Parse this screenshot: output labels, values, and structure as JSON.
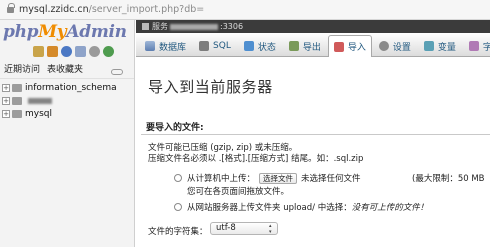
{
  "browser": {
    "url_host": "mysql.zzidc.cn",
    "url_path": "/server_import.php?db="
  },
  "logo": {
    "php": "php",
    "my": "My",
    "admin": "Admin"
  },
  "nav": {
    "icons": [
      "home-icon",
      "database-icon",
      "help-icon",
      "docs-icon",
      "settings-icon",
      "reload-icon"
    ],
    "recent_label": "近期访问",
    "favorites_label": "表收藏夹",
    "tree": [
      {
        "label": "information_schema",
        "expander": "+"
      },
      {
        "label": "",
        "expander": "+"
      },
      {
        "label": "mysql",
        "expander": "+"
      }
    ]
  },
  "topbar": {
    "prefix": "服务",
    "suffix": ":3306"
  },
  "tabs": [
    {
      "label": "数据库",
      "icon": "database-icon"
    },
    {
      "label": "SQL",
      "icon": "sql-icon"
    },
    {
      "label": "状态",
      "icon": "status-icon"
    },
    {
      "label": "导出",
      "icon": "export-icon"
    },
    {
      "label": "导入",
      "icon": "import-icon",
      "active": true
    },
    {
      "label": "设置",
      "icon": "settings-icon"
    },
    {
      "label": "变量",
      "icon": "variables-icon"
    },
    {
      "label": "字",
      "icon": "charset-icon"
    }
  ],
  "main": {
    "title": "导入到当前服务器",
    "section_heading": "要导入的文件:",
    "compress_line1": "文件可能已压缩 (gzip, zip) 或未压缩。",
    "compress_line2": "压缩文件名必须以 .[格式].[压缩方式] 结尾。如：.sql.zip",
    "upload_from_computer": "从计算机中上传：",
    "choose_file_button": "选择文件",
    "no_file_chosen": "未选择任何文件",
    "max_limit": "(最大限制：50 MB",
    "drag_hint": "您可在各页面间拖放文件。",
    "upload_from_server": "从网站服务器上传文件夹 upload/ 中选择：",
    "no_uploadable": "没有可上传的文件！",
    "charset_label": "文件的字符集：",
    "charset_value": "utf-8"
  }
}
